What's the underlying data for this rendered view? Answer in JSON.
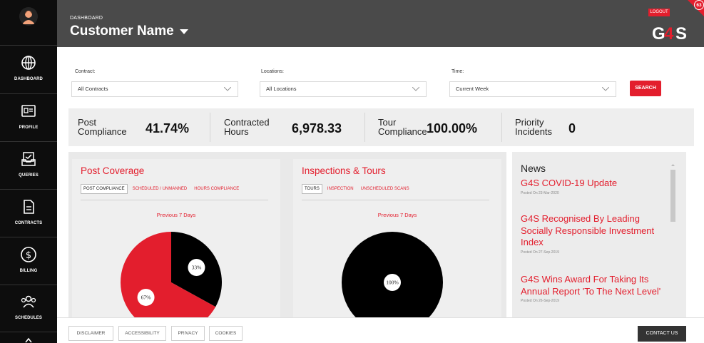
{
  "header": {
    "section": "DASHBOARD",
    "customer": "Customer Name",
    "logout": "LOGOUT",
    "badge_count": "63",
    "logo_text": "G4S"
  },
  "sidebar": {
    "items": [
      {
        "label": "DASHBOARD",
        "icon": "globe-icon"
      },
      {
        "label": "PROFILE",
        "icon": "id-card-icon"
      },
      {
        "label": "QUERIES",
        "icon": "inbox-icon"
      },
      {
        "label": "CONTRACTS",
        "icon": "document-icon"
      },
      {
        "label": "BILLING",
        "icon": "dollar-icon"
      },
      {
        "label": "SCHEDULES",
        "icon": "people-icon"
      }
    ]
  },
  "filters": {
    "contract": {
      "label": "Contract:",
      "value": "All Contracts"
    },
    "locations": {
      "label": "Locations:",
      "value": "All Locations"
    },
    "time": {
      "label": "Time:",
      "value": "Current Week"
    },
    "search_label": "SEARCH"
  },
  "kpis": [
    {
      "label1": "Post",
      "label2": "Compliance",
      "value": "41.74%"
    },
    {
      "label1": "Contracted",
      "label2": "Hours",
      "value": "6,978.33"
    },
    {
      "label1": "Tour",
      "label2": "Compliance",
      "value": "100.00%"
    },
    {
      "label1": "Priority",
      "label2": "Incidents",
      "value": "0"
    }
  ],
  "panels": {
    "coverage": {
      "title": "Post Coverage",
      "tabs": [
        "POST COMPLIANCE",
        "SCHEDULED / UNMANNED",
        "HOURS COMPLIANCE"
      ],
      "chart_title": "Previous 7 Days"
    },
    "inspections": {
      "title": "Inspections & Tours",
      "tabs": [
        "TOURS",
        "INSPECTION",
        "UNSCHEDULED SCANS"
      ],
      "chart_title": "Previous 7 Days"
    }
  },
  "chart_data": [
    {
      "type": "pie",
      "title": "Previous 7 Days",
      "labels": [
        "67%",
        "33%"
      ],
      "values": [
        67,
        33
      ],
      "colors": [
        "#e31e2d",
        "#000000"
      ]
    },
    {
      "type": "pie",
      "title": "Previous 7 Days",
      "labels": [
        "100%"
      ],
      "values": [
        100
      ],
      "colors": [
        "#000000"
      ]
    }
  ],
  "news": {
    "heading": "News",
    "items": [
      {
        "title": "G4S COVID-19 Update",
        "date": "Posted On 23-Mar-2020"
      },
      {
        "title": "G4S Recognised By Leading Socially Responsible Investment Index",
        "date": "Posted On 27-Sep-2019"
      },
      {
        "title": "G4S Wins Award For Taking Its Annual Report 'To The Next Level'",
        "date": "Posted On 26-Sep-2019"
      }
    ]
  },
  "footer": {
    "disclaimer": "DISCLAIMER",
    "accessibility": "ACCESSIBILITY",
    "privacy": "PRIVACY",
    "cookies": "COOKIES",
    "contact": "CONTACT US"
  },
  "colors": {
    "accent": "#e31e2d",
    "header_bg": "#4a4a4a",
    "sidebar_bg": "#0d0d0d"
  }
}
